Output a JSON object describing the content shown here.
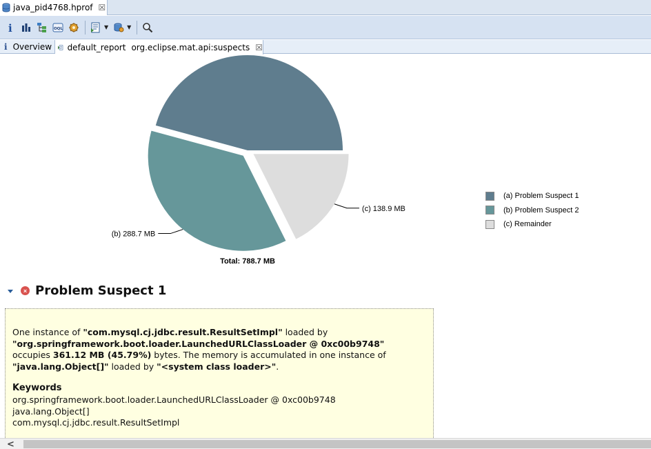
{
  "editor_tab": {
    "label": "java_pid4768.hprof",
    "close": "☒"
  },
  "toolbar": {
    "items": [
      "info-icon",
      "histogram-icon",
      "dominator-tree-icon",
      "oql-icon",
      "thread-overview-icon",
      "reports-icon",
      "query-browser-icon",
      "search-icon"
    ]
  },
  "inner_tabs": {
    "overview_icon": "i",
    "overview": "Overview",
    "report": "default_report",
    "report_sub": "org.eclipse.mat.api:suspects",
    "close": "☒"
  },
  "chart_data": {
    "type": "pie",
    "categories": [
      "(a)  Problem Suspect 1",
      "(b)  Problem Suspect 2",
      "(c)  Remainder"
    ],
    "values": [
      361.1,
      288.7,
      138.9
    ],
    "units": "MB",
    "slice_labels": [
      "",
      "(b)  288.7 MB",
      "(c)  138.9 MB"
    ],
    "colors": [
      "#5f7d8e",
      "#66979a",
      "#dddddd"
    ],
    "total_label": "Total: 788.7 MB",
    "legend_position": "right"
  },
  "suspect": {
    "title": "Problem Suspect 1",
    "err_icon": "×",
    "line1_pre": "One instance of ",
    "line1_class": "\"com.mysql.cj.jdbc.result.ResultSetImpl\"",
    "line1_post": " loaded by",
    "line2_loader": "\"org.springframework.boot.loader.LaunchedURLClassLoader @ 0xc00b9748\"",
    "line3_pre": "occupies ",
    "line3_size": "361.12 MB (45.79%)",
    "line3_post": " bytes. The memory is accumulated in one instance of",
    "line4_obj": "\"java.lang.Object[]\"",
    "line4_mid": " loaded by ",
    "line4_loader": "\"<system class loader>\"",
    "line4_end": ".",
    "keywords_title": "Keywords",
    "keywords": [
      "org.springframework.boot.loader.LaunchedURLClassLoader @ 0xc00b9748",
      "java.lang.Object[]",
      "com.mysql.cj.jdbc.result.ResultSetImpl"
    ]
  },
  "scrollbar": {
    "left_arrow": "<"
  }
}
